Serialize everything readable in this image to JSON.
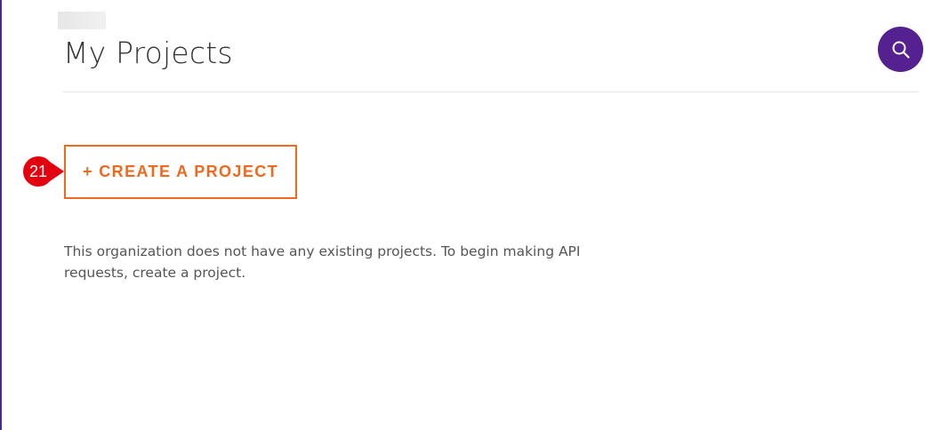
{
  "header": {
    "title": "My Projects",
    "search_icon": "search-icon"
  },
  "main": {
    "create_button_label": "+ CREATE A PROJECT",
    "step_badge": "21",
    "empty_message": "This organization does not have any existing projects. To begin making API requests, create a project."
  },
  "colors": {
    "accent": "#ef6a1e",
    "brand": "#55208f",
    "badge": "#e3000f"
  }
}
